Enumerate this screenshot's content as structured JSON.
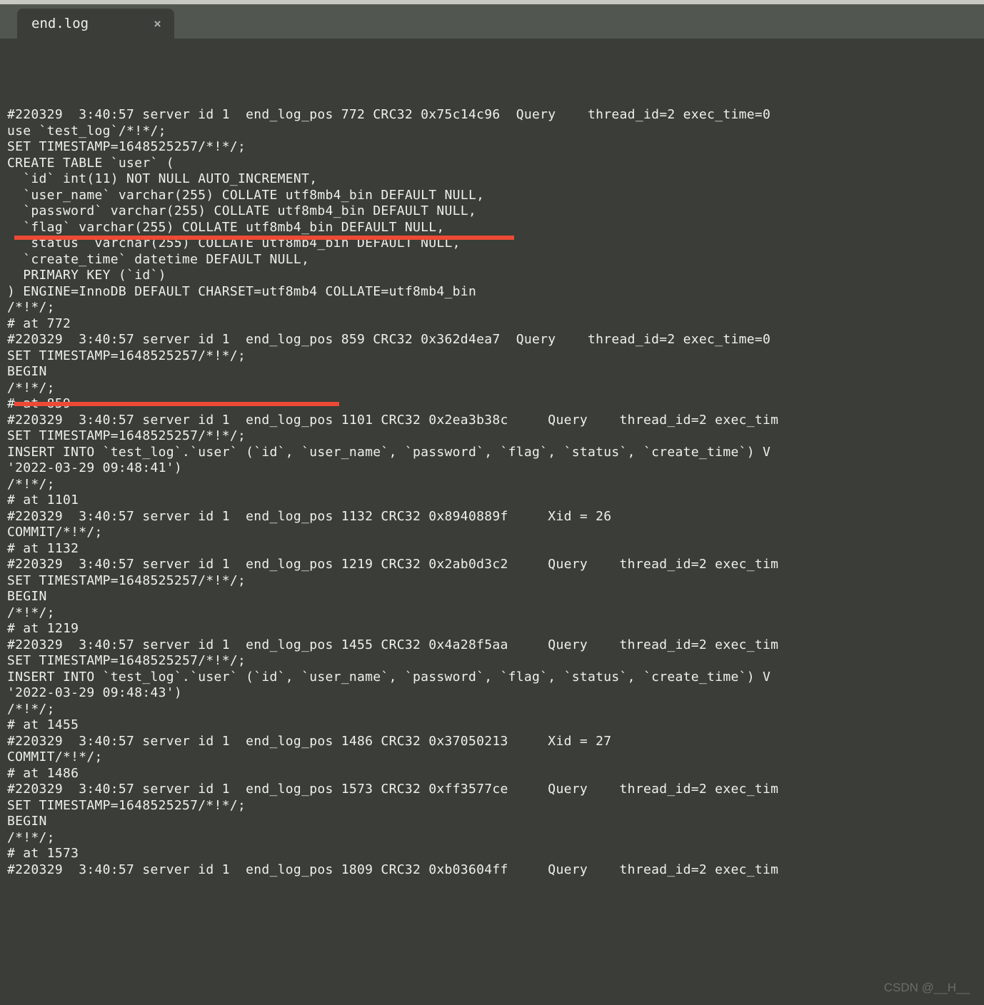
{
  "tab": {
    "filename": "end.log",
    "close": "×"
  },
  "watermark": "CSDN @__H__",
  "log_lines": [
    "#220329  3:40:57 server id 1  end_log_pos 772 CRC32 0x75c14c96  Query    thread_id=2 exec_time=0",
    "use `test_log`/*!*/;",
    "SET TIMESTAMP=1648525257/*!*/;",
    "CREATE TABLE `user` (",
    "  `id` int(11) NOT NULL AUTO_INCREMENT,",
    "  `user_name` varchar(255) COLLATE utf8mb4_bin DEFAULT NULL,",
    "  `password` varchar(255) COLLATE utf8mb4_bin DEFAULT NULL,",
    "  `flag` varchar(255) COLLATE utf8mb4_bin DEFAULT NULL,",
    "  `status` varchar(255) COLLATE utf8mb4_bin DEFAULT NULL,",
    "  `create_time` datetime DEFAULT NULL,",
    "  PRIMARY KEY (`id`)",
    ") ENGINE=InnoDB DEFAULT CHARSET=utf8mb4 COLLATE=utf8mb4_bin",
    "/*!*/;",
    "# at 772",
    "#220329  3:40:57 server id 1  end_log_pos 859 CRC32 0x362d4ea7  Query    thread_id=2 exec_time=0",
    "SET TIMESTAMP=1648525257/*!*/;",
    "BEGIN",
    "/*!*/;",
    "# at 859",
    "#220329  3:40:57 server id 1  end_log_pos 1101 CRC32 0x2ea3b38c     Query    thread_id=2 exec_tim",
    "SET TIMESTAMP=1648525257/*!*/;",
    "INSERT INTO `test_log`.`user` (`id`, `user_name`, `password`, `flag`, `status`, `create_time`) V",
    "'2022-03-29 09:48:41')",
    "/*!*/;",
    "# at 1101",
    "#220329  3:40:57 server id 1  end_log_pos 1132 CRC32 0x8940889f     Xid = 26",
    "COMMIT/*!*/;",
    "# at 1132",
    "#220329  3:40:57 server id 1  end_log_pos 1219 CRC32 0x2ab0d3c2     Query    thread_id=2 exec_tim",
    "SET TIMESTAMP=1648525257/*!*/;",
    "BEGIN",
    "/*!*/;",
    "# at 1219",
    "#220329  3:40:57 server id 1  end_log_pos 1455 CRC32 0x4a28f5aa     Query    thread_id=2 exec_tim",
    "SET TIMESTAMP=1648525257/*!*/;",
    "INSERT INTO `test_log`.`user` (`id`, `user_name`, `password`, `flag`, `status`, `create_time`) V",
    "'2022-03-29 09:48:43')",
    "/*!*/;",
    "# at 1455",
    "#220329  3:40:57 server id 1  end_log_pos 1486 CRC32 0x37050213     Xid = 27",
    "COMMIT/*!*/;",
    "# at 1486",
    "#220329  3:40:57 server id 1  end_log_pos 1573 CRC32 0xff3577ce     Query    thread_id=2 exec_tim",
    "SET TIMESTAMP=1648525257/*!*/;",
    "BEGIN",
    "/*!*/;",
    "# at 1573",
    "#220329  3:40:57 server id 1  end_log_pos 1809 CRC32 0xb03604ff     Query    thread_id=2 exec_tim"
  ]
}
